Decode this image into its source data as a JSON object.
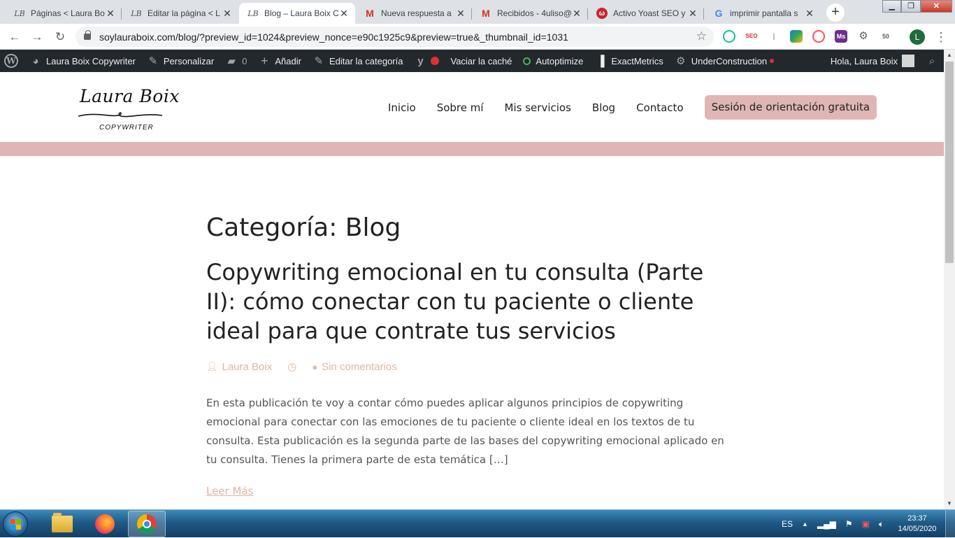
{
  "browser": {
    "tabs": [
      {
        "title": "Páginas < Laura Bo",
        "icon": "lb-logo-icon"
      },
      {
        "title": "Editar la página < L",
        "icon": "lb-logo-icon"
      },
      {
        "title": "Blog – Laura Boix C",
        "icon": "lb-logo-icon",
        "active": true
      },
      {
        "title": "Nueva respuesta a",
        "icon": "gmail-icon"
      },
      {
        "title": "Recibidos - 4uliso@",
        "icon": "gmail-icon"
      },
      {
        "title": "Activo Yoast SEO y",
        "icon": "yoast-icon"
      },
      {
        "title": "imprimir pantalla s",
        "icon": "google-icon"
      }
    ],
    "tab_close": "✕",
    "new_tab": "+",
    "window_controls": {
      "minimize": "▁",
      "maximize": "❐",
      "close": "✕"
    },
    "url": "soylauraboix.com/blog/?preview_id=1024&preview_nonce=e90c1925c9&preview=true&_thumbnail_id=1031",
    "profile_initial": "L",
    "extensions": {
      "seo": "SEO",
      "ms": "Ms",
      "text_cursor": "I",
      "fifty": "50"
    }
  },
  "admin_bar": {
    "site_name": "Laura Boix Copywriter",
    "customize": "Personalizar",
    "comments_count": "0",
    "add_new": "Añadir",
    "edit_category": "Editar la categoría",
    "clear_cache": "Vaciar la caché",
    "autoptimize": "Autoptimize",
    "exactmetrics": "ExactMetrics",
    "underconstruction": "UnderConstruction",
    "greeting": "Hola, Laura Boix"
  },
  "site": {
    "logo_name": "Laura Boix",
    "logo_sub": "COPYWRITER",
    "nav": [
      "Inicio",
      "Sobre mí",
      "Mis servicios",
      "Blog",
      "Contacto"
    ],
    "cta": "Sesión de orientación gratuita",
    "accent_color": "#dfb6b4"
  },
  "content": {
    "category_title": "Categoría: Blog",
    "post_title": "Copywriting emocional en tu consulta (Parte II): cómo conectar con tu paciente o cliente ideal para que contrate tus servicios",
    "author": "Laura Boix",
    "comments": "Sin comentarios",
    "excerpt": "En esta publicación te voy a contar cómo puedes aplicar algunos principios de copywriting emocional para conectar con las emociones de tu paciente o cliente ideal en los textos de tu consulta. Esta publicación es la segunda parte de las bases del copywriting emocional aplicado en tu consulta. Tienes la primera parte de esta temática […]",
    "read_more": "Leer Más"
  },
  "taskbar": {
    "language": "ES",
    "time": "23:37",
    "date": "14/05/2020"
  }
}
